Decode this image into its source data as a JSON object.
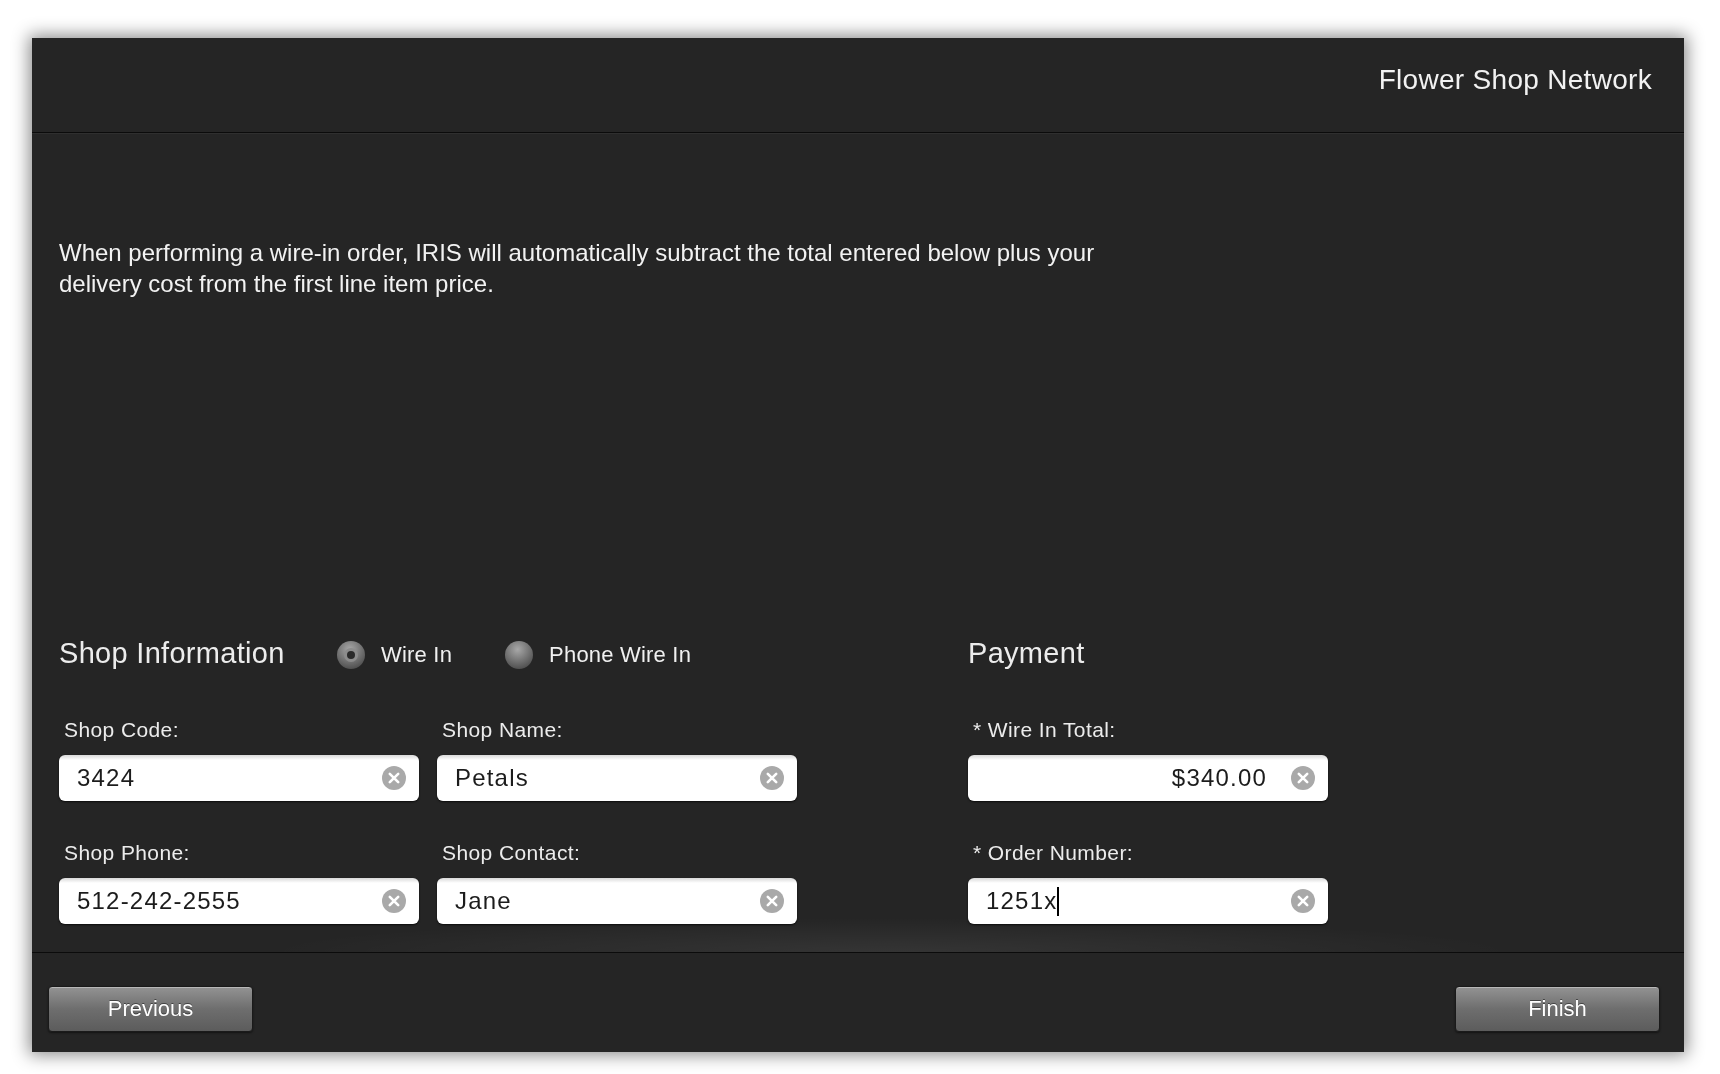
{
  "header": {
    "title": "Flower Shop Network"
  },
  "intro": "When performing a wire-in order, IRIS will automatically subtract the total entered below plus your delivery cost from the first line item price.",
  "sections": [
    {
      "title": "Shop Information",
      "options": [
        {
          "label": "Wire In",
          "selected": true
        },
        {
          "label": "Phone Wire In",
          "selected": false
        }
      ],
      "fields": [
        {
          "label": "Shop Code:",
          "value": "3424",
          "kind": "text",
          "focused": false
        },
        {
          "label": "Shop Name:",
          "value": "Petals",
          "kind": "text",
          "focused": false
        },
        {
          "label": "Shop Phone:",
          "value": "512-242-2555",
          "kind": "text",
          "focused": false
        },
        {
          "label": "Shop Contact:",
          "value": "Jane",
          "kind": "text",
          "focused": false
        }
      ]
    },
    {
      "title": "Payment",
      "fields": [
        {
          "label": "* Wire In Total:",
          "value": "$340.00",
          "kind": "amount",
          "focused": false
        },
        {
          "label": "* Order Number:",
          "value": "1251x",
          "kind": "text",
          "focused": true
        }
      ]
    }
  ],
  "buttons": [
    {
      "label": "Previous"
    },
    {
      "label": "Finish"
    }
  ]
}
